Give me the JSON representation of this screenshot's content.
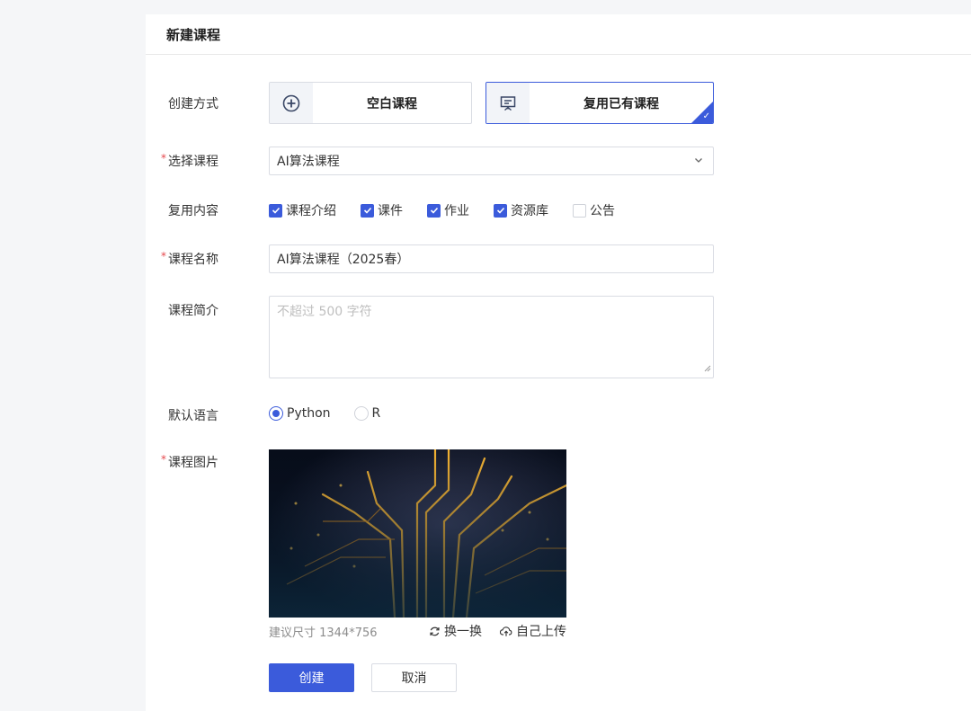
{
  "panel": {
    "title": "新建课程"
  },
  "form": {
    "create_mode": {
      "label": "创建方式",
      "options": [
        {
          "label": "空白课程",
          "icon": "plus-circle-icon",
          "selected": false
        },
        {
          "label": "复用已有课程",
          "icon": "presentation-board-icon",
          "selected": true
        }
      ]
    },
    "course_select": {
      "label": "选择课程",
      "required": "*",
      "value": "AI算法课程"
    },
    "reuse_content": {
      "label": "复用内容",
      "options": [
        {
          "label": "课程介绍",
          "checked": true
        },
        {
          "label": "课件",
          "checked": true
        },
        {
          "label": "作业",
          "checked": true
        },
        {
          "label": "资源库",
          "checked": true
        },
        {
          "label": "公告",
          "checked": false
        }
      ]
    },
    "course_name": {
      "label": "课程名称",
      "required": "*",
      "value": "AI算法课程（2025春）"
    },
    "course_intro": {
      "label": "课程简介",
      "placeholder": "不超过 500 字符"
    },
    "default_language": {
      "label": "默认语言",
      "options": [
        {
          "label": "Python",
          "selected": true
        },
        {
          "label": "R",
          "selected": false
        }
      ]
    },
    "course_image": {
      "label": "课程图片",
      "required": "*",
      "hint": "建议尺寸 1344*756",
      "swap_label": "换一换",
      "upload_label": "自己上传"
    }
  },
  "actions": {
    "create_label": "创建",
    "cancel_label": "取消"
  },
  "colors": {
    "primary": "#3b5bdb",
    "required": "#e5484d",
    "border": "#d9dce3"
  }
}
